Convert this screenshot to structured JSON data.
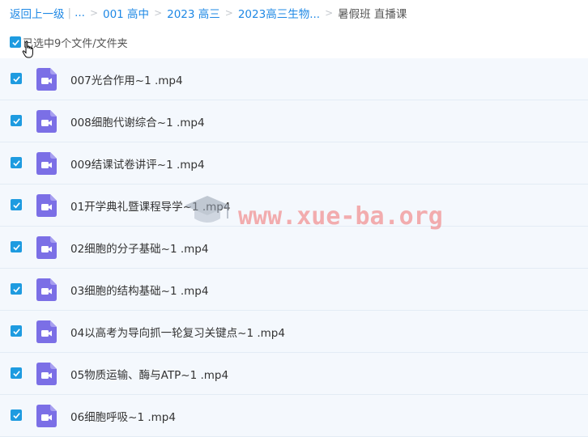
{
  "breadcrumb": {
    "back": "返回上一级",
    "ellipsis": "...",
    "items": [
      "001 高中",
      "2023 高三",
      "2023高三生物..."
    ],
    "current": "暑假班 直播课"
  },
  "selection": {
    "label": "已选中9个文件/文件夹"
  },
  "files": [
    {
      "name": "007光合作用~1 .mp4"
    },
    {
      "name": "008细胞代谢综合~1 .mp4"
    },
    {
      "name": "009结课试卷讲评~1 .mp4"
    },
    {
      "name": "01开学典礼暨课程导学~1 .mp4"
    },
    {
      "name": "02细胞的分子基础~1 .mp4"
    },
    {
      "name": "03细胞的结构基础~1 .mp4"
    },
    {
      "name": "04以高考为导向抓一轮复习关键点~1 .mp4"
    },
    {
      "name": "05物质运输、酶与ATP~1 .mp4"
    },
    {
      "name": "06细胞呼吸~1 .mp4"
    }
  ],
  "watermark": {
    "text": "www.xue-ba.org"
  },
  "colors": {
    "accent": "#1e88e5",
    "checkbox": "#1e9be0",
    "video_icon": "#7b6fe6",
    "row_bg": "#f4f8fd"
  },
  "icons": {
    "file": "video-file-icon",
    "check": "check-icon"
  }
}
